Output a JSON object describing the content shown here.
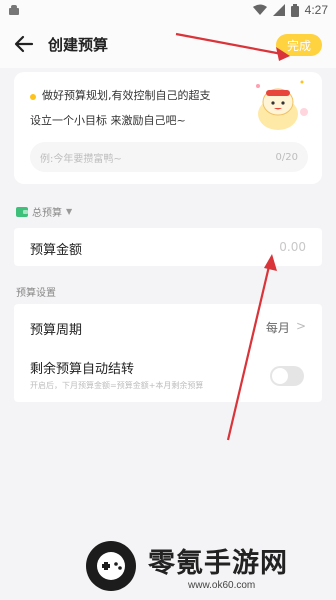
{
  "status_bar": {
    "time": "4:27"
  },
  "header": {
    "title": "创建预算",
    "done_label": "完成"
  },
  "goal_card": {
    "line1": "做好预算规划,有效控制自己的超支",
    "line2": "设立一个小目标 来激励自己吧~",
    "input_placeholder": "例:今年要攒富鸭~",
    "char_count": "0/20"
  },
  "budget_section": {
    "tag": "总预算",
    "amount_label": "预算金额",
    "amount_value": "0.00"
  },
  "settings": {
    "header": "预算设置",
    "period_label": "预算周期",
    "period_value": "每月",
    "rollover_label": "剩余预算自动结转",
    "rollover_desc": "开启后，下月预算金额=预算金额+本月剩余预算",
    "rollover_enabled": false
  },
  "watermark": {
    "name": "零氪手游网",
    "url": "www.ok60.com"
  },
  "colors": {
    "accent": "#ffd23f",
    "arrow": "#d9343a"
  }
}
